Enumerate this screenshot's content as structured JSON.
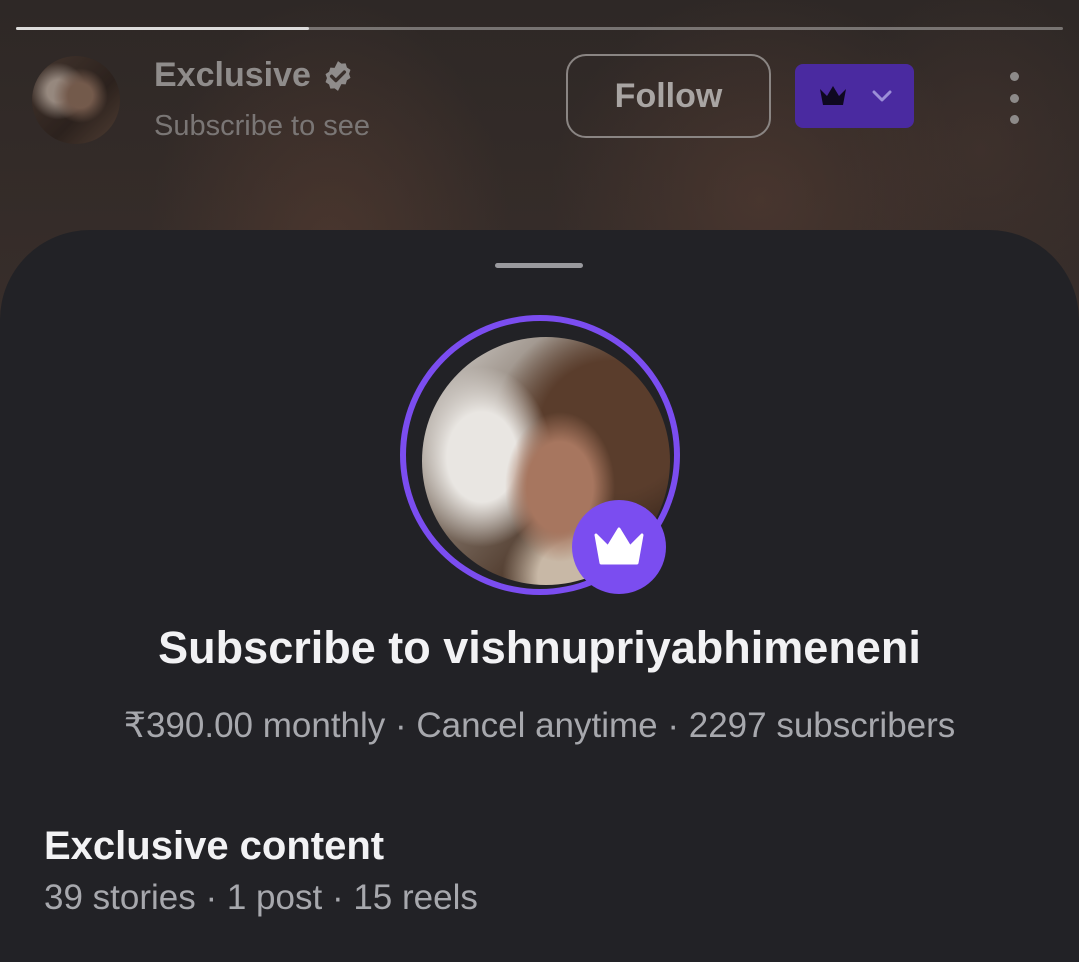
{
  "story": {
    "progress": 0.28
  },
  "header": {
    "title": "Exclusive",
    "subtitle": "Subscribe to see",
    "follow_label": "Follow",
    "icons": {
      "verified": "verified-badge-icon",
      "crown": "crown-icon",
      "chevron": "chevron-down-icon",
      "more": "more-vertical-icon"
    }
  },
  "sheet": {
    "title": "Subscribe to vishnupriyabhimeneni",
    "price": "₹390.00 monthly",
    "separator": " · ",
    "cancel_text": "Cancel anytime",
    "subscribers": "2297 subscribers",
    "section_title": "Exclusive content",
    "stories": "39 stories",
    "posts": "1 post",
    "reels": "15 reels"
  },
  "colors": {
    "accent": "#7b4df0",
    "sheet_bg": "#222226",
    "crown_button_bg": "#4a2aa0"
  }
}
